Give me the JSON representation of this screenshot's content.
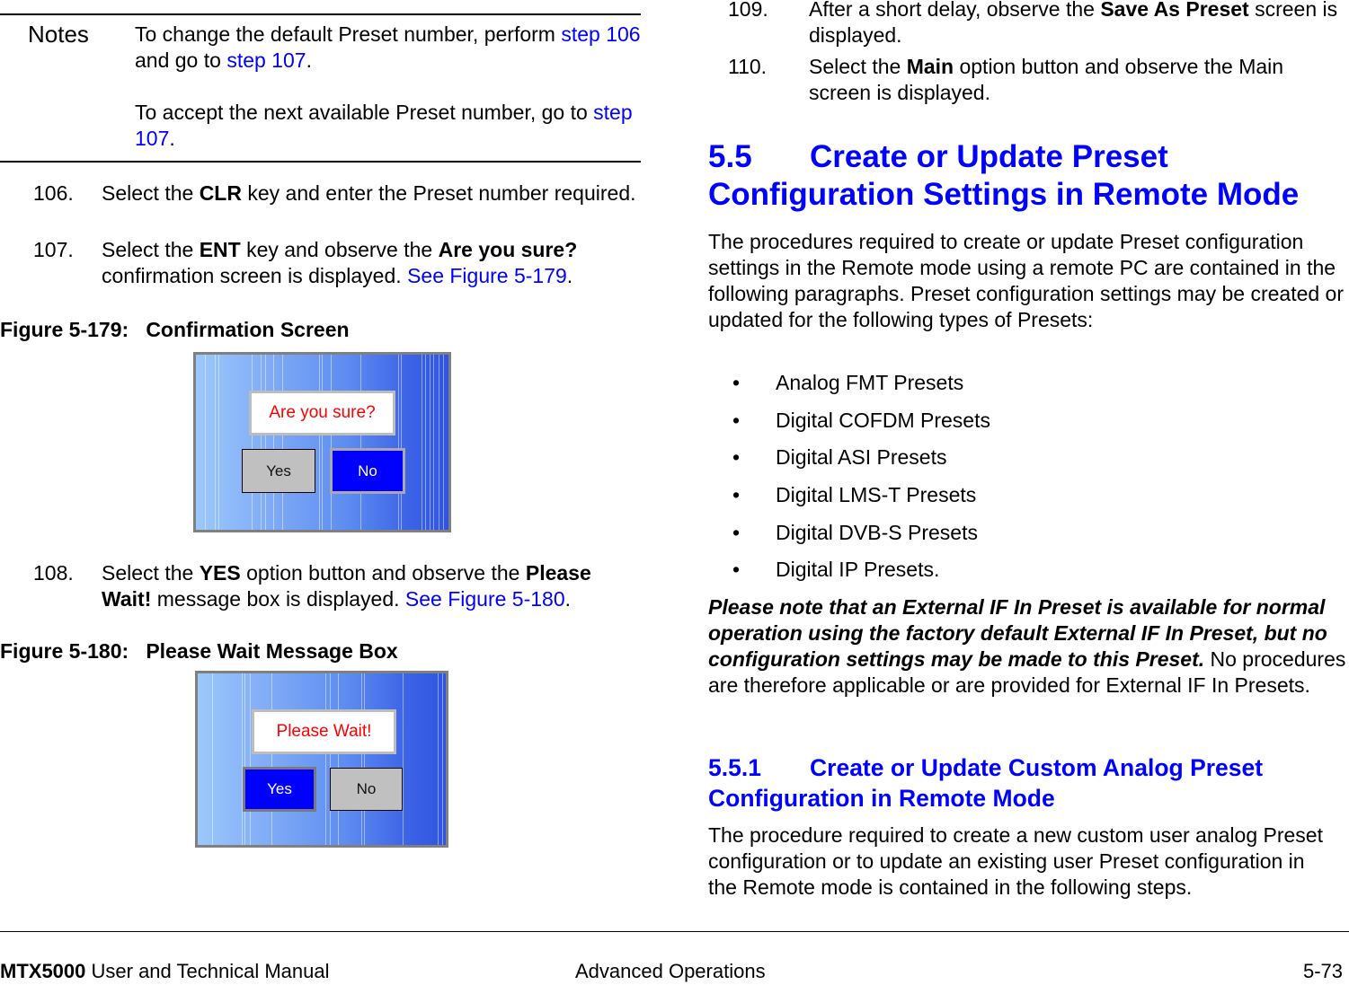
{
  "notes": {
    "label": "Notes",
    "para1": {
      "t1": "To change the default Preset number, perform ",
      "link1": "step 106",
      "t2": " and go to ",
      "link2": "step 107",
      "t3": "."
    },
    "para2": {
      "t1": "To accept the next available Preset number, go to ",
      "link1": "step 107",
      "t2": "."
    }
  },
  "steps": {
    "s106": {
      "num": "106.",
      "t1": "Select the ",
      "b1": "CLR",
      "t2": " key and enter the Preset number required."
    },
    "s107": {
      "num": "107.",
      "t1": "Select the ",
      "b1": "ENT",
      "t2": " key and observe the ",
      "b2": "Are you sure?",
      "t3": " confirmation screen is displayed.  ",
      "link": "See Figure 5-179",
      "t4": "."
    },
    "s108": {
      "num": "108.",
      "t1": "Select the ",
      "b1": "YES",
      "t2": " option button and observe the ",
      "b2": "Please Wait!",
      "t3": " message box is displayed.  ",
      "link": "See Figure 5-180",
      "t4": "."
    },
    "s109": {
      "num": "109.",
      "t1": "After a short delay, observe the ",
      "b1": "Save As Preset",
      "t2": " screen is displayed."
    },
    "s110": {
      "num": "110.",
      "t1": "Select the ",
      "b1": "Main",
      "t2": " option button and observe the Main screen is displayed."
    }
  },
  "figures": {
    "f179": {
      "caption": "Figure 5-179:   Confirmation Screen",
      "message": "Are you sure?",
      "yes_label": "Yes",
      "no_label": "No",
      "selected": "No"
    },
    "f180": {
      "caption": "Figure 5-180:   Please Wait Message Box",
      "message": "Please Wait!",
      "yes_label": "Yes",
      "no_label": "No",
      "selected": "Yes"
    }
  },
  "section_5_5": {
    "number": "5.5",
    "title": "Create or Update Preset Configuration Settings in Remote Mode",
    "intro": "The procedures required to create or update Preset configuration settings in the Remote mode using a remote PC are contained in the following paragraphs.  Preset configuration settings may be created or updated for the following types of Presets:",
    "bullet_glyph": "•",
    "bullets": [
      "Analog FMT Presets",
      "Digital COFDM Presets",
      "Digital ASI Presets",
      "Digital LMS-T Presets",
      "Digital DVB-S Presets",
      "Digital IP Presets."
    ],
    "note_bold_italic": "Please note that an External IF In Preset is available for normal operation using the factory default External IF In Preset, but no configuration settings may be made to this Preset.",
    "note_rest": "  No procedures are therefore applicable or are provided for External IF In Presets."
  },
  "section_5_5_1": {
    "number": "5.5.1",
    "title": "Create or Update Custom Analog Preset Configuration in Remote Mode",
    "body": "The procedure required to create a new custom user analog Preset configuration or to update an existing user Preset configuration in the Remote mode is contained in the following steps."
  },
  "footer": {
    "product": "MTX5000",
    "manual": " User and Technical Manual",
    "chapter": "Advanced Operations",
    "page": "5-73"
  }
}
